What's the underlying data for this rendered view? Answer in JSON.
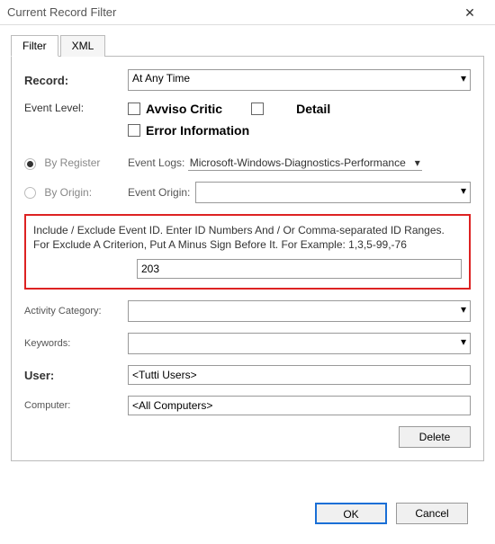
{
  "titlebar": {
    "title": "Current Record Filter"
  },
  "tabs": {
    "filter": "Filter",
    "xml": "XML"
  },
  "labels": {
    "record": "Record:",
    "event_level": "Event Level:",
    "by_register": "By Register",
    "by_origin": "By Origin:",
    "event_logs": "Event Logs:",
    "event_origin": "Event Origin:",
    "activity_category": "Activity Category:",
    "keywords": "Keywords:",
    "user": "User:",
    "computer": "Computer:"
  },
  "record_select": "At Any Time",
  "checks": {
    "avviso": "Avviso Critic",
    "detail": "Detail",
    "error_info": "Error Information"
  },
  "event_logs_value": "Microsoft-Windows-Diagnostics-Performance",
  "redbox": {
    "help": "Include / Exclude Event ID. Enter ID Numbers And / Or Comma-separated ID Ranges. For Exclude A Criterion, Put A Minus Sign Before It. For Example: 1,3,5-99,-76",
    "value": "203"
  },
  "user_value": "<Tutti Users>",
  "computer_value": "<All Computers>",
  "buttons": {
    "delete": "Delete",
    "ok": "OK",
    "cancel": "Cancel"
  }
}
